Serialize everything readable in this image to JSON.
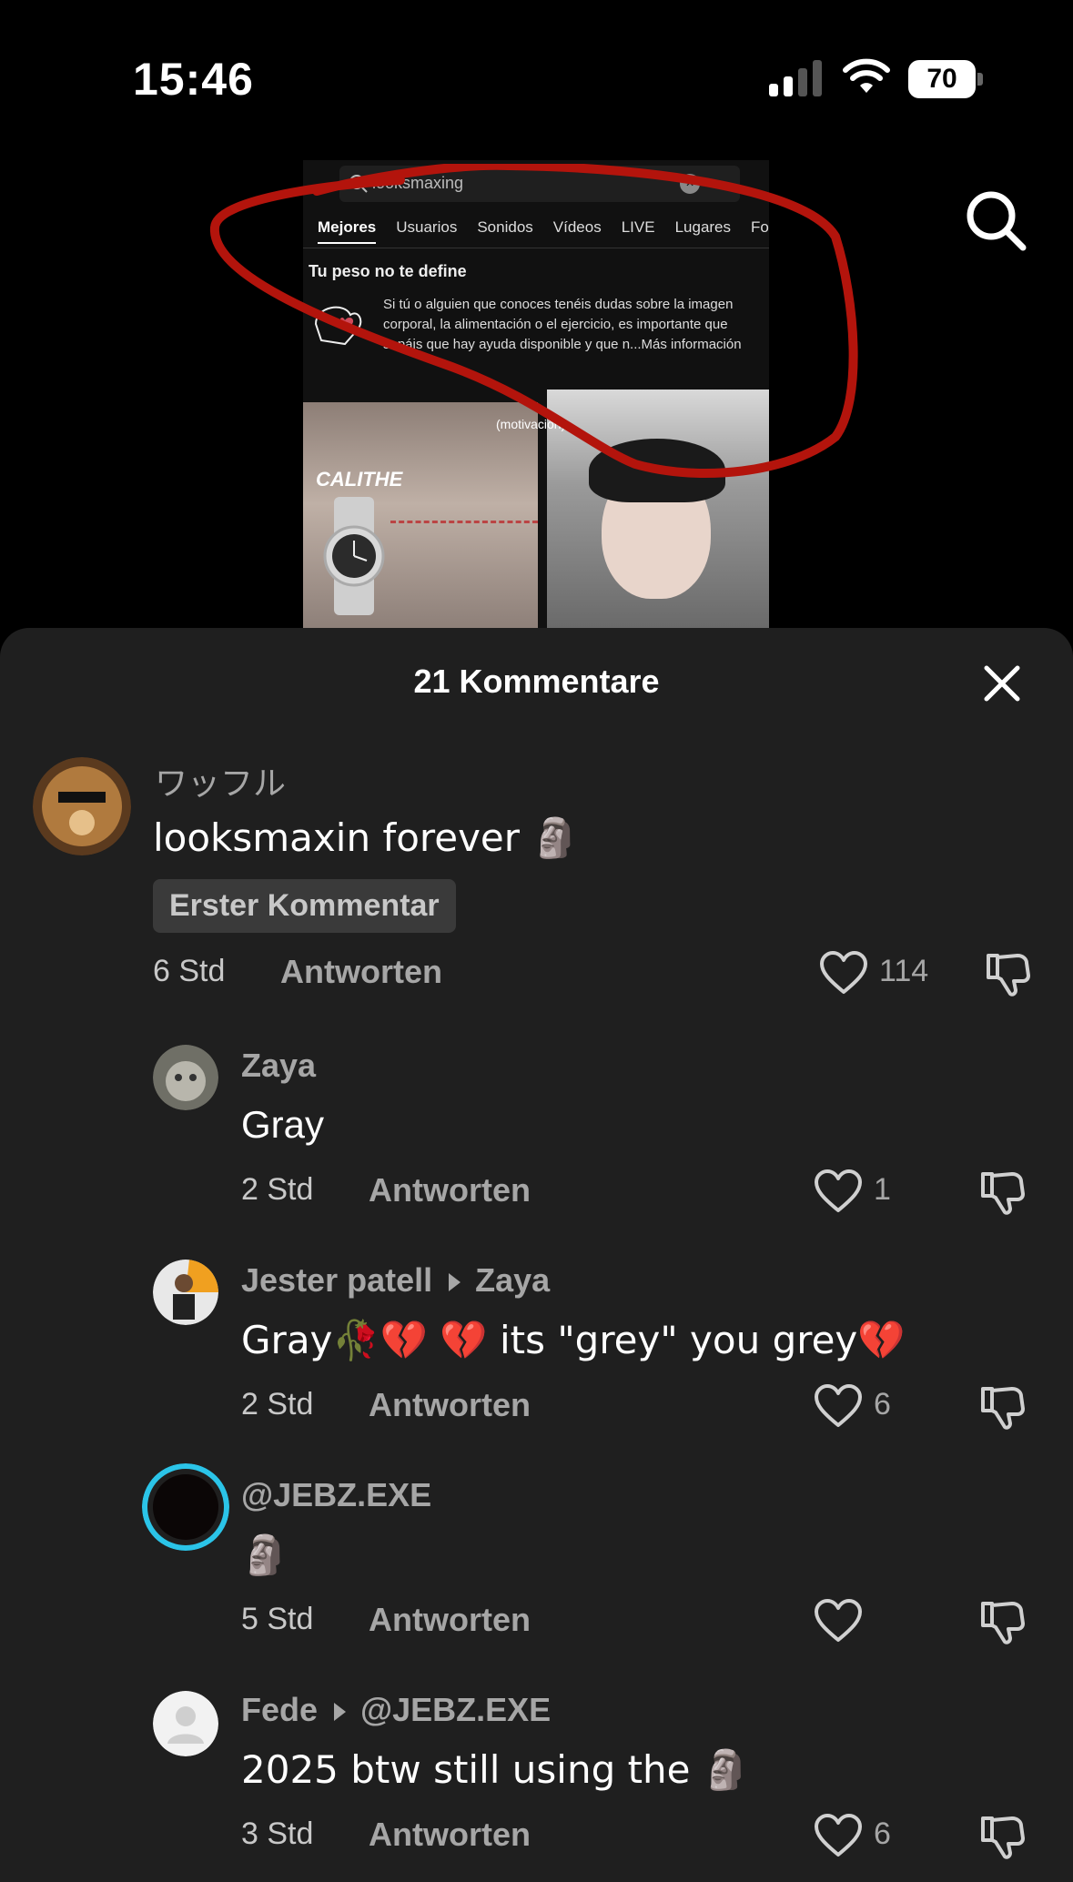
{
  "status_bar": {
    "time": "15:46",
    "battery": "70"
  },
  "preview": {
    "search_query": "looksmaxing",
    "tabs": [
      "Mejores",
      "Usuarios",
      "Sonidos",
      "Vídeos",
      "LIVE",
      "Lugares",
      "Fo"
    ],
    "notice_title": "Tu peso no te define",
    "notice_lines": [
      "Si tú o alguien que conoces tenéis dudas sobre la imagen",
      "corporal, la alimentación o el ejercicio, es importante que",
      "sepáis que hay ayuda disponible y que n...Más información"
    ],
    "brand_label": "CALITHE",
    "caption": "(motivación)"
  },
  "sheet": {
    "title": "21 Kommentare"
  },
  "comments": [
    {
      "user": "ワッフル",
      "text": "looksmaxin forever 🗿",
      "badge": "Erster Kommentar",
      "time": "6 Std",
      "reply": "Antworten",
      "likes": "114"
    },
    {
      "user": "Zaya",
      "text": "Gray",
      "time": "2 Std",
      "reply": "Antworten",
      "likes": "1"
    },
    {
      "user": "Jester patell",
      "reply_to": "Zaya",
      "text": "Gray🥀💔 💔 its \"grey\" you grey💔",
      "time": "2 Std",
      "reply": "Antworten",
      "likes": "6"
    },
    {
      "user": "@JEBZ.EXE",
      "text": "🗿",
      "time": "5 Std",
      "reply": "Antworten",
      "likes": ""
    },
    {
      "user": "Fede",
      "reply_to": "@JEBZ.EXE",
      "text": "2025 btw still using the 🗿",
      "time": "3 Std",
      "reply": "Antworten",
      "likes": "6"
    }
  ],
  "colors": {
    "sheet_bg": "#1f1f1f",
    "annotation_red": "#b3140c",
    "story_ring": "#2bc4e8"
  }
}
